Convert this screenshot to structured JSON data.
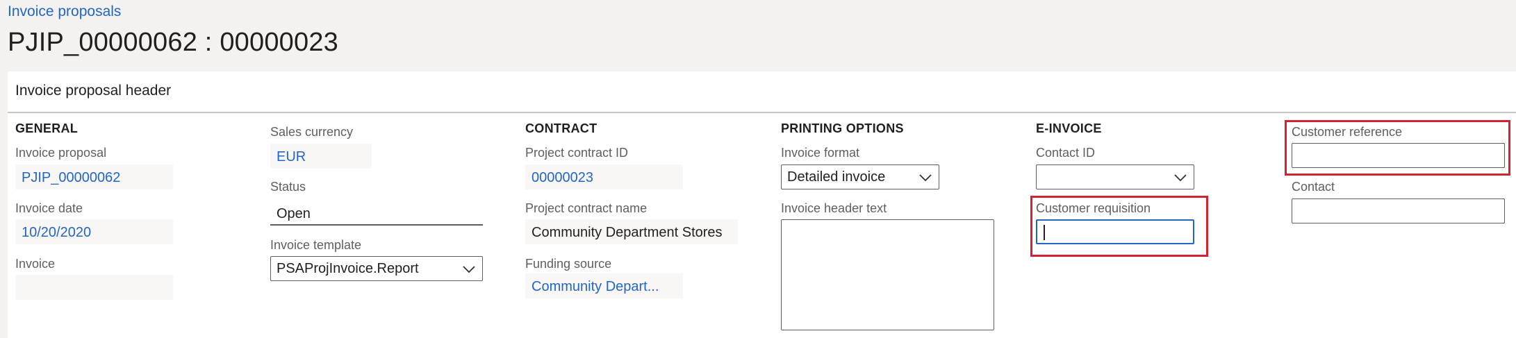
{
  "breadcrumb": "Invoice proposals",
  "page_title": "PJIP_00000062 : 00000023",
  "panel": {
    "header": "Invoice proposal header"
  },
  "general": {
    "heading": "GENERAL",
    "invoice_proposal_label": "Invoice proposal",
    "invoice_proposal_value": "PJIP_00000062",
    "invoice_date_label": "Invoice date",
    "invoice_date_value": "10/20/2020",
    "invoice_label": "Invoice",
    "invoice_value": ""
  },
  "currency_status": {
    "sales_currency_label": "Sales currency",
    "sales_currency_value": "EUR",
    "status_label": "Status",
    "status_value": "Open",
    "invoice_template_label": "Invoice template",
    "invoice_template_value": "PSAProjInvoice.Report"
  },
  "contract": {
    "heading": "CONTRACT",
    "project_contract_id_label": "Project contract ID",
    "project_contract_id_value": "00000023",
    "project_contract_name_label": "Project contract name",
    "project_contract_name_value": "Community Department Stores",
    "funding_source_label": "Funding source",
    "funding_source_value": "Community Depart..."
  },
  "printing": {
    "heading": "PRINTING OPTIONS",
    "invoice_format_label": "Invoice format",
    "invoice_format_value": "Detailed invoice",
    "invoice_header_text_label": "Invoice header text",
    "invoice_header_text_value": ""
  },
  "einvoice": {
    "heading": "E-INVOICE",
    "contact_id_label": "Contact ID",
    "contact_id_value": "",
    "customer_requisition_label": "Customer requisition",
    "customer_requisition_value": ""
  },
  "customer": {
    "customer_reference_label": "Customer reference",
    "customer_reference_value": "",
    "contact_label": "Contact",
    "contact_value": ""
  },
  "colors": {
    "link": "#2266c5",
    "highlight": "#d1222f",
    "focus": "#2266c5"
  },
  "icons": {
    "dropdown": "chevron-down-icon"
  }
}
